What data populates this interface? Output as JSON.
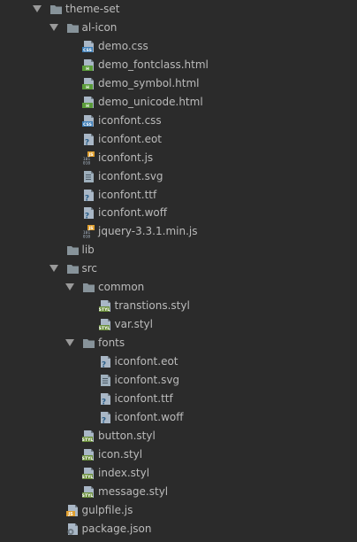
{
  "tree": {
    "items": [
      {
        "label": "theme-set",
        "kind": "folder",
        "depth": 0,
        "expanded": true,
        "icon": "folder-icon"
      },
      {
        "label": "al-icon",
        "kind": "folder",
        "depth": 1,
        "expanded": true,
        "icon": "folder-icon"
      },
      {
        "label": "demo.css",
        "kind": "css",
        "depth": 2,
        "icon": "css-file-icon"
      },
      {
        "label": "demo_fontclass.html",
        "kind": "html",
        "depth": 2,
        "icon": "html-file-icon"
      },
      {
        "label": "demo_symbol.html",
        "kind": "html",
        "depth": 2,
        "icon": "html-file-icon"
      },
      {
        "label": "demo_unicode.html",
        "kind": "html",
        "depth": 2,
        "icon": "html-file-icon"
      },
      {
        "label": "iconfont.css",
        "kind": "css",
        "depth": 2,
        "icon": "css-file-icon"
      },
      {
        "label": "iconfont.eot",
        "kind": "unknown",
        "depth": 2,
        "icon": "unknown-file-icon"
      },
      {
        "label": "iconfont.js",
        "kind": "js-binary",
        "depth": 2,
        "icon": "js-binary-file-icon"
      },
      {
        "label": "iconfont.svg",
        "kind": "text",
        "depth": 2,
        "icon": "text-file-icon"
      },
      {
        "label": "iconfont.ttf",
        "kind": "unknown",
        "depth": 2,
        "icon": "unknown-file-icon"
      },
      {
        "label": "iconfont.woff",
        "kind": "unknown",
        "depth": 2,
        "icon": "unknown-file-icon"
      },
      {
        "label": "jquery-3.3.1.min.js",
        "kind": "js-binary",
        "depth": 2,
        "icon": "js-binary-file-icon"
      },
      {
        "label": "lib",
        "kind": "folder",
        "depth": 1,
        "expanded": false,
        "icon": "folder-icon"
      },
      {
        "label": "src",
        "kind": "folder",
        "depth": 1,
        "expanded": true,
        "icon": "folder-icon"
      },
      {
        "label": "common",
        "kind": "folder",
        "depth": 2,
        "expanded": true,
        "icon": "folder-icon"
      },
      {
        "label": "transtions.styl",
        "kind": "styl",
        "depth": 3,
        "icon": "stylus-file-icon"
      },
      {
        "label": "var.styl",
        "kind": "styl",
        "depth": 3,
        "icon": "stylus-file-icon"
      },
      {
        "label": "fonts",
        "kind": "folder",
        "depth": 2,
        "expanded": true,
        "icon": "folder-icon"
      },
      {
        "label": "iconfont.eot",
        "kind": "unknown",
        "depth": 3,
        "icon": "unknown-file-icon"
      },
      {
        "label": "iconfont.svg",
        "kind": "text",
        "depth": 3,
        "icon": "text-file-icon"
      },
      {
        "label": "iconfont.ttf",
        "kind": "unknown",
        "depth": 3,
        "icon": "unknown-file-icon"
      },
      {
        "label": "iconfont.woff",
        "kind": "unknown",
        "depth": 3,
        "icon": "unknown-file-icon"
      },
      {
        "label": "button.styl",
        "kind": "styl",
        "depth": 2,
        "icon": "stylus-file-icon"
      },
      {
        "label": "icon.styl",
        "kind": "styl",
        "depth": 2,
        "icon": "stylus-file-icon"
      },
      {
        "label": "index.styl",
        "kind": "styl",
        "depth": 2,
        "icon": "stylus-file-icon"
      },
      {
        "label": "message.styl",
        "kind": "styl",
        "depth": 2,
        "icon": "stylus-file-icon"
      },
      {
        "label": "gulpfile.js",
        "kind": "js",
        "depth": 1,
        "icon": "js-file-icon"
      },
      {
        "label": "package.json",
        "kind": "json",
        "depth": 1,
        "icon": "json-file-icon"
      }
    ]
  },
  "colors": {
    "background": "#2b2b2b",
    "text": "#bbbbbb",
    "arrow": "#9a9a9a",
    "folder": "#87939a",
    "css_badge": "#3d7eb8",
    "html_badge": "#5b9c3a",
    "styl_badge": "#6a8f3a",
    "js_badge": "#e0a030"
  }
}
